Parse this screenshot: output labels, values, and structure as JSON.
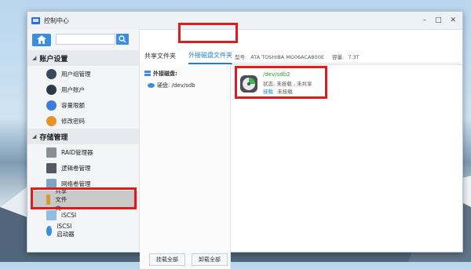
{
  "window": {
    "title": "控制中心",
    "controls": [
      "–",
      "□",
      "✕"
    ]
  },
  "search": {
    "placeholder": ""
  },
  "sidebar": {
    "sections": [
      {
        "label": "账户设置",
        "items": [
          {
            "label": "用户组管理",
            "icon": "user-group-icon",
            "color": "#3a4a5c"
          },
          {
            "label": "用户账户",
            "icon": "user-icon",
            "color": "#2b3a4a"
          },
          {
            "label": "容量限额",
            "icon": "quota-icon",
            "color": "#3d7bd9"
          },
          {
            "label": "修改密码",
            "icon": "password-icon",
            "color": "#e7932a"
          }
        ]
      },
      {
        "label": "存储管理",
        "items": [
          {
            "label": "RAID管理器",
            "icon": "raid-icon",
            "color": "#8a8f95"
          },
          {
            "label": "逻辑卷管理",
            "icon": "volume-icon",
            "color": "#555a60"
          },
          {
            "label": "网络卷管理",
            "icon": "network-volume-icon",
            "color": "#7aa6c9"
          },
          {
            "label": "共享文件夹",
            "icon": "shared-folder-icon",
            "color": "#d39b2a"
          },
          {
            "label": "iSCSI",
            "icon": "iscsi-icon",
            "color": "#8fc0e3"
          },
          {
            "label": "iSCSI 启动器",
            "icon": "iscsi-initiator-icon",
            "color": "#3b8de0"
          }
        ]
      }
    ],
    "active_item": "共享文件夹"
  },
  "tabs": [
    {
      "label": "共享文件夹"
    },
    {
      "label": "外接磁盘文件夹"
    }
  ],
  "active_tab": "外接磁盘文件夹",
  "left_panel": {
    "title": "外接磁盘:",
    "disk_label": "硬盘: /dev/sdb"
  },
  "buttons": {
    "mount_all": "挂载全部",
    "unmount_all": "卸载全部"
  },
  "disk_info": {
    "model_label": "型号:",
    "model": "ATA TOSHIBA MG06ACA800E",
    "capacity_label": "容量:",
    "capacity": "7.3T"
  },
  "partition": {
    "name": "/dev/sdb2",
    "status": "状态: 未挂载 , 未共享",
    "mount_link": "挂载",
    "mount_status": "未挂载"
  },
  "colors": {
    "accent": "#1e7fd8",
    "highlight": "#e01b1b",
    "partition_name": "#2a9a35"
  }
}
